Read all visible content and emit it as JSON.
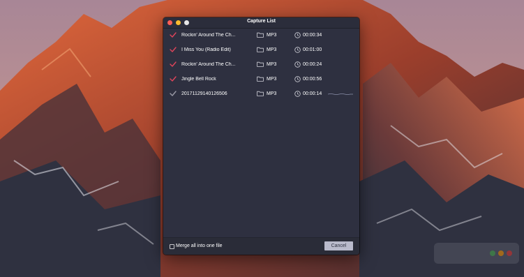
{
  "window": {
    "title": "Capture List"
  },
  "items": [
    {
      "checked": true,
      "name": "Rockin' Around The Ch...",
      "format": "MP3",
      "duration": "00:00:34",
      "recording": false
    },
    {
      "checked": true,
      "name": "I Miss You (Radio Edit)",
      "format": "MP3",
      "duration": "00:01:00",
      "recording": false
    },
    {
      "checked": true,
      "name": "Rockin' Around The Ch...",
      "format": "MP3",
      "duration": "00:00:24",
      "recording": false
    },
    {
      "checked": true,
      "name": "Jingle Bell Rock",
      "format": "MP3",
      "duration": "00:00:56",
      "recording": false
    },
    {
      "checked": false,
      "name": "20171129140126506",
      "format": "MP3",
      "duration": "00:00:14",
      "recording": true
    }
  ],
  "footer": {
    "merge_label": "Merge all into one file",
    "merge_checked": false,
    "cancel_label": "Cancel"
  },
  "icons": {
    "check": "check-icon",
    "folder": "folder-icon",
    "clock": "clock-icon",
    "waveform": "waveform-icon"
  },
  "colors": {
    "check_active": "#e0455b",
    "check_inactive": "#9a9aa6",
    "window_bg": "#2e3040",
    "button_bg": "#b9bacb"
  }
}
